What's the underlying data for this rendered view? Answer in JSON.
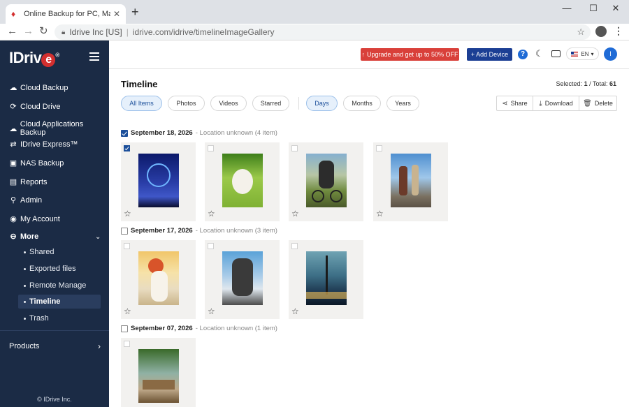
{
  "browser": {
    "tab_title": "Online Backup for PC, Mac and iP",
    "site_label": "Idrive Inc [US]",
    "url": "idrive.com/idrive/timelineImageGallery"
  },
  "sidebar": {
    "logo": "IDrive",
    "items": [
      {
        "label": "Cloud Backup",
        "icon": "cloud-upload-icon"
      },
      {
        "label": "Cloud Drive",
        "icon": "sync-icon"
      },
      {
        "label": "Cloud Applications Backup",
        "icon": "cloud-icon"
      },
      {
        "label": "IDrive Express™",
        "icon": "express-icon"
      },
      {
        "label": "NAS Backup",
        "icon": "nas-icon"
      },
      {
        "label": "Reports",
        "icon": "report-icon"
      },
      {
        "label": "Admin",
        "icon": "admin-icon"
      },
      {
        "label": "My Account",
        "icon": "account-icon"
      },
      {
        "label": "More",
        "icon": "minus-circle-icon"
      }
    ],
    "sub_items": [
      {
        "label": "Shared"
      },
      {
        "label": "Exported files"
      },
      {
        "label": "Remote Manage"
      },
      {
        "label": "Timeline",
        "active": true
      },
      {
        "label": "Trash"
      }
    ],
    "products": "Products",
    "copyright": "© IDrive Inc."
  },
  "topbar": {
    "upgrade": "Upgrade and get up to 50% OFF",
    "add_device": "+ Add Device",
    "language": "EN",
    "avatar_initial": "I"
  },
  "main": {
    "title": "Timeline",
    "selected_label": "Selected:",
    "selected": "1",
    "total_label": "/ Total:",
    "total": "61",
    "filters": [
      "All Items",
      "Photos",
      "Videos",
      "Starred"
    ],
    "views": [
      "Days",
      "Months",
      "Years"
    ],
    "actions": [
      "Share",
      "Download",
      "Delete"
    ],
    "groups": [
      {
        "date": "September 18, 2026",
        "location": "- Location unknown (4 item)",
        "checked": true
      },
      {
        "date": "September 17, 2026",
        "location": "- Location unknown (3 item)",
        "checked": false
      },
      {
        "date": "September 07, 2026",
        "location": "- Location unknown (1 item)",
        "checked": false
      }
    ]
  },
  "colors": {
    "sidebar_bg": "#1b2b45",
    "accent_blue": "#1c3f94",
    "upgrade_red": "#d9403a",
    "active_filter_bg": "#e6f0fb"
  }
}
